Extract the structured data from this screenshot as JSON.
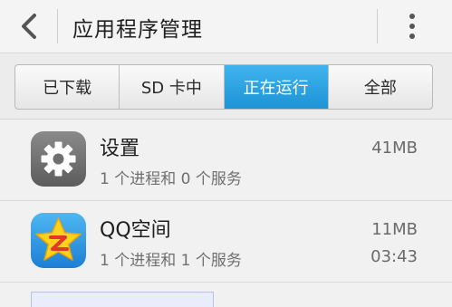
{
  "header": {
    "title": "应用程序管理"
  },
  "tabs": [
    {
      "label": "已下载",
      "active": false
    },
    {
      "label": "SD 卡中",
      "active": false
    },
    {
      "label": "正在运行",
      "active": true
    },
    {
      "label": "全部",
      "active": false
    }
  ],
  "apps": [
    {
      "name": "设置",
      "detail": "1 个进程和 0 个服务",
      "size": "41MB",
      "time": "",
      "icon": "gear-icon"
    },
    {
      "name": "QQ空间",
      "detail": "1 个进程和 1 个服务",
      "size": "11MB",
      "time": "03:43",
      "icon": "qzone-icon"
    }
  ],
  "colors": {
    "active_tab": "#1e93d6",
    "background": "#f1f1f1"
  }
}
